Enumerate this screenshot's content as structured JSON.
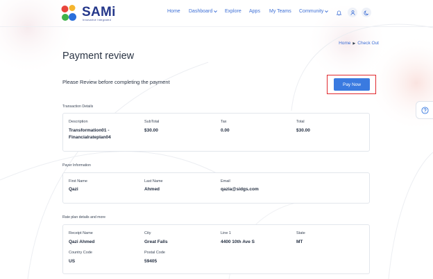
{
  "brand": {
    "name": "SAMi",
    "tagline": "Innovative Integrated",
    "logo_colors": [
      "#e8453c",
      "#f5b52e",
      "#3fb24a",
      "#2a6fdb"
    ]
  },
  "nav": {
    "items": [
      {
        "label": "Home",
        "caret": false
      },
      {
        "label": "Dashboard",
        "caret": true
      },
      {
        "label": "Explore",
        "caret": false
      },
      {
        "label": "Apps",
        "caret": false
      },
      {
        "label": "My Teams",
        "caret": false
      },
      {
        "label": "Community",
        "caret": true
      }
    ],
    "icons": [
      "bell-icon",
      "user-icon",
      "moon-icon"
    ]
  },
  "breadcrumb": {
    "home": "Home",
    "current": "Check Out"
  },
  "page": {
    "title": "Payment review",
    "subtitle": "Please Review before completing the payment",
    "pay_button": "Pay Now"
  },
  "transaction": {
    "title": "Transaction Details",
    "headers": {
      "description": "Description",
      "subtotal": "SubTotal",
      "tax": "Tax",
      "total": "Total"
    },
    "description": "Transformation01 - Financialrateplan04",
    "subtotal": "$30.00",
    "tax": "0.00",
    "total": "$30.00"
  },
  "payer": {
    "title": "Payer Information",
    "headers": {
      "first_name": "First Name",
      "last_name": "Last Name",
      "email": "Email"
    },
    "first_name": "Qazi",
    "last_name": "Ahmed",
    "email": "qazia@sidgs.com"
  },
  "rate_plan": {
    "title": "Rate plan details and more",
    "headers": {
      "receipt_name": "Receipt Name",
      "city": "City",
      "line1": "Line 1",
      "state": "State",
      "country_code": "Country Code",
      "postal_code": "Postal Code"
    },
    "receipt_name": "Qazi Ahmed",
    "city": "Great Falls",
    "line1": "4400 10th Ave S",
    "state": "MT",
    "country_code": "US",
    "postal_code": "59405"
  },
  "help": {
    "icon": "question-circle-icon"
  },
  "colors": {
    "accent": "#3a7ae0",
    "link": "#3d6fd6",
    "highlight": "#e0282d",
    "brand_text": "#24378a"
  }
}
